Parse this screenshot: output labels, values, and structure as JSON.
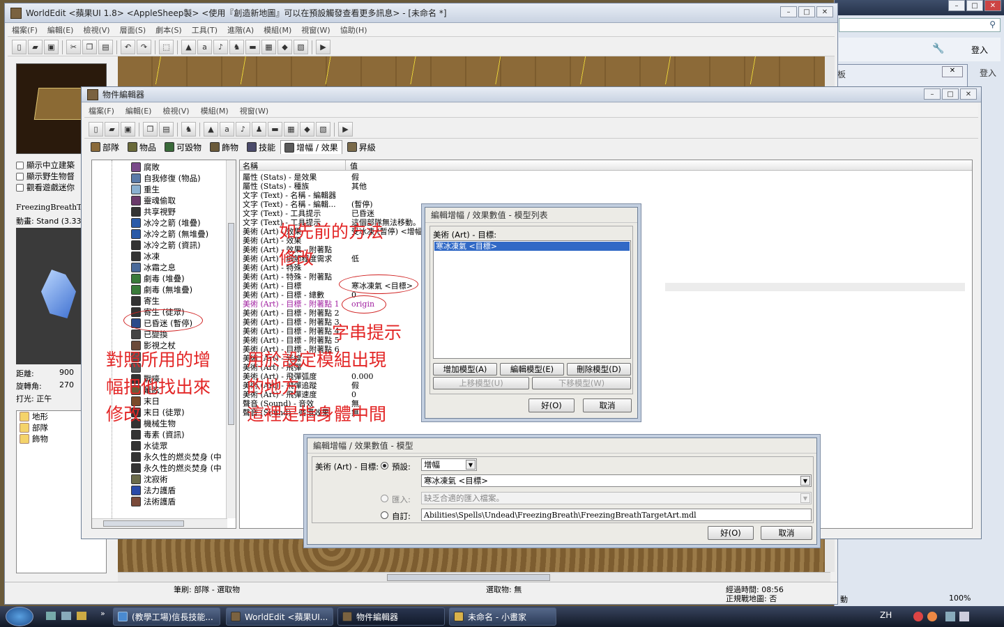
{
  "main_window": {
    "title": "WorldEdit <蘋果UI 1.8> <AppleSheep製> <使用『創造新地圖』可以在預設觸發查看更多訊息> - [未命名 *]",
    "menus": [
      "檔案(F)",
      "編輯(E)",
      "檢視(V)",
      "層面(S)",
      "劇本(S)",
      "工具(T)",
      "進階(A)",
      "模組(M)",
      "視窗(W)",
      "協助(H)"
    ],
    "left": {
      "checkboxes": [
        "顯示中立建築",
        "顯示野生物督",
        "觀看遊戲迷你"
      ],
      "model_label": "FreezingBreathTarg",
      "anim_label": "動畫: Stand (3.334",
      "distance_label": "距離:",
      "distance_value": "900",
      "rotation_label": "旋轉角:",
      "rotation_value": "270",
      "light_label": "打光: 正午",
      "folders": [
        "地形",
        "部隊",
        "飾物"
      ]
    },
    "status": {
      "brush": "筆刷: 部隊 - 選取物",
      "selection": "選取物: 無",
      "elapsed": "經過時間: 08:56",
      "fog": "正規戰地圖: 否"
    }
  },
  "browser_bg": {
    "login_btn": "登入",
    "login_link": "登入",
    "zoom": "100%",
    "status_text": "動"
  },
  "tool_palette": {
    "title": "工具色板"
  },
  "object_editor": {
    "title": "物件編輯器",
    "menus": [
      "檔案(F)",
      "編輯(E)",
      "檢視(V)",
      "模組(M)",
      "視窗(W)"
    ],
    "tabs": [
      "部隊",
      "物品",
      "可毀物",
      "飾物",
      "技能",
      "增幅 / 效果",
      "昇級"
    ],
    "tree": [
      "腐敗",
      "自我修復 (物品)",
      "重生",
      "靈魂偷取",
      "共享視野",
      "冰冷之箭 (堆疊)",
      "冰冷之箭 (無堆疊)",
      "冰冷之箭 (資訊)",
      "冰凍",
      "冰霜之息",
      "劇毒 (堆疊)",
      "劇毒 (無堆疊)",
      "寄生",
      "寄生 (徒眾)",
      "已昏迷 (暫停)",
      "已變換",
      "影視之杖",
      "",
      "",
      "戰嚎",
      "暈眩",
      "末日",
      "末日 (徒眾)",
      "機械生物",
      "毒素 (資訊)",
      "水徒眾",
      "永久性的燃炎焚身 (中",
      "永久性的燃炎焚身 (中",
      "沈寂術",
      "法力護盾",
      "法術護盾"
    ],
    "col_name": "名稱",
    "col_value": "值",
    "grid": [
      [
        "屬性 (Stats) - 是效果",
        "假"
      ],
      [
        "屬性 (Stats) - 種族",
        "其他"
      ],
      [
        "文字 (Text) - 名稱 - 編輯器",
        ""
      ],
      [
        "文字 (Text) - 名稱 - 編輯...",
        "(暫停)"
      ],
      [
        "文字 (Text) - 工具提示",
        "已昏迷"
      ],
      [
        "文字 (Text) - 工具提示",
        "這個部隊無法移動。"
      ],
      [
        "美術 (Art) - 效果",
        "受冰凍 (暫停) <增幅>"
      ],
      [
        "美術 (Art) - 效果",
        ""
      ],
      [
        "美術 (Art) - 效果 - 附著點",
        ""
      ],
      [
        "美術 (Art) - 細節程度需求",
        "低"
      ],
      [
        "美術 (Art) - 特殊",
        ""
      ],
      [
        "美術 (Art) - 特殊 - 附著點",
        ""
      ],
      [
        "美術 (Art) - 目標",
        "寒冰凍氣 <目標>"
      ],
      [
        "美術 (Art) - 目標 - 總數",
        "0"
      ],
      [
        "美術 (Art) - 目標 - 附著點 1",
        "origin"
      ],
      [
        "美術 (Art) - 目標 - 附著點 2",
        ""
      ],
      [
        "美術 (Art) - 目標 - 附著點 3",
        ""
      ],
      [
        "美術 (Art) - 目標 - 附著點 4",
        ""
      ],
      [
        "美術 (Art) - 目標 - 附著點 5",
        ""
      ],
      [
        "美術 (Art) - 目標 - 附著點 6",
        ""
      ],
      [
        "美術 (Art) - 光線",
        ""
      ],
      [
        "美術 (Art) - 飛彈",
        ""
      ],
      [
        "美術 (Art) - 飛彈弧度",
        "0.000"
      ],
      [
        "美術 (Art) - 飛彈追蹤",
        "假"
      ],
      [
        "美術 (Art) - 飛彈速度",
        "0"
      ],
      [
        "聲音 (Sound) - 音效",
        "無"
      ],
      [
        "聲音 (Sound) - 循環效果",
        "無"
      ]
    ]
  },
  "model_list_dialog": {
    "title": "編輯增幅 / 效果數值 - 模型列表",
    "label": "美術 (Art) - 目標:",
    "items": [
      "寒冰凍氣 <目標>"
    ],
    "add": "增加模型(A)",
    "edit": "編輯模型(E)",
    "delete": "刪除模型(D)",
    "up": "上移模型(U)",
    "down": "下移模型(W)",
    "ok": "好(O)",
    "cancel": "取消"
  },
  "model_dialog": {
    "title": "編輯增幅 / 效果數值 - 模型",
    "label": "美術 (Art) - 目標:",
    "opt_default": "預設:",
    "opt_import": "匯入:",
    "opt_custom": "自訂:",
    "category": "增幅",
    "default_value": "寒冰凍氣 <目標>",
    "import_value": "缺乏合適的匯入檔案。",
    "custom_value": "Abilities\\Spells\\Undead\\FreezingBreath\\FreezingBreathTargetArt.mdl",
    "ok": "好(O)",
    "cancel": "取消"
  },
  "annotations": {
    "a1": "如先前的方法",
    "a1b": "修改",
    "a2": "字串提示",
    "a3": "對照所用的增",
    "a3b": "幅把他找出來",
    "a3c": "修改",
    "a4": "用於設定模組出現",
    "a4b": "的地方",
    "a5": "這裡是指身體中間"
  },
  "taskbar": {
    "items": [
      "(教學工場)信長技能...",
      "WorldEdit <蘋果UI...",
      "物件編輯器",
      "未命名 - 小畫家"
    ],
    "lang": "ZH",
    "clock": ""
  }
}
